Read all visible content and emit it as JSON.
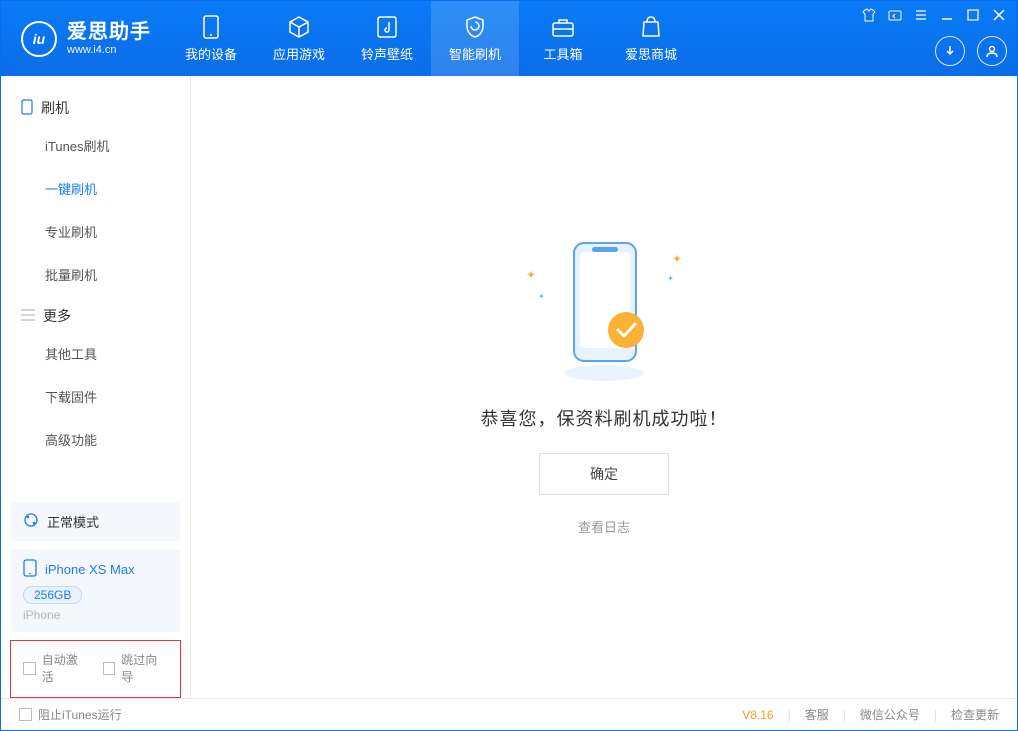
{
  "app": {
    "title": "爱思助手",
    "subtitle": "www.i4.cn"
  },
  "tabs": [
    {
      "label": "我的设备"
    },
    {
      "label": "应用游戏"
    },
    {
      "label": "铃声壁纸"
    },
    {
      "label": "智能刷机"
    },
    {
      "label": "工具箱"
    },
    {
      "label": "爱思商城"
    }
  ],
  "sidebar": {
    "group1": {
      "title": "刷机"
    },
    "flash": {
      "itunes": "iTunes刷机",
      "oneclick": "一键刷机",
      "pro": "专业刷机",
      "batch": "批量刷机"
    },
    "group2": {
      "title": "更多"
    },
    "more": {
      "other": "其他工具",
      "firmware": "下载固件",
      "advanced": "高级功能"
    },
    "mode": {
      "label": "正常模式"
    },
    "device": {
      "name": "iPhone XS Max",
      "storage": "256GB",
      "type": "iPhone"
    },
    "options": {
      "auto_activate": "自动激活",
      "skip_guide": "跳过向导"
    }
  },
  "main": {
    "success_text": "恭喜您，保资料刷机成功啦！",
    "ok_button": "确定",
    "view_log": "查看日志"
  },
  "status": {
    "prevent_itunes": "阻止iTunes运行",
    "version": "V8.16",
    "support": "客服",
    "wechat": "微信公众号",
    "check_update": "检查更新"
  }
}
